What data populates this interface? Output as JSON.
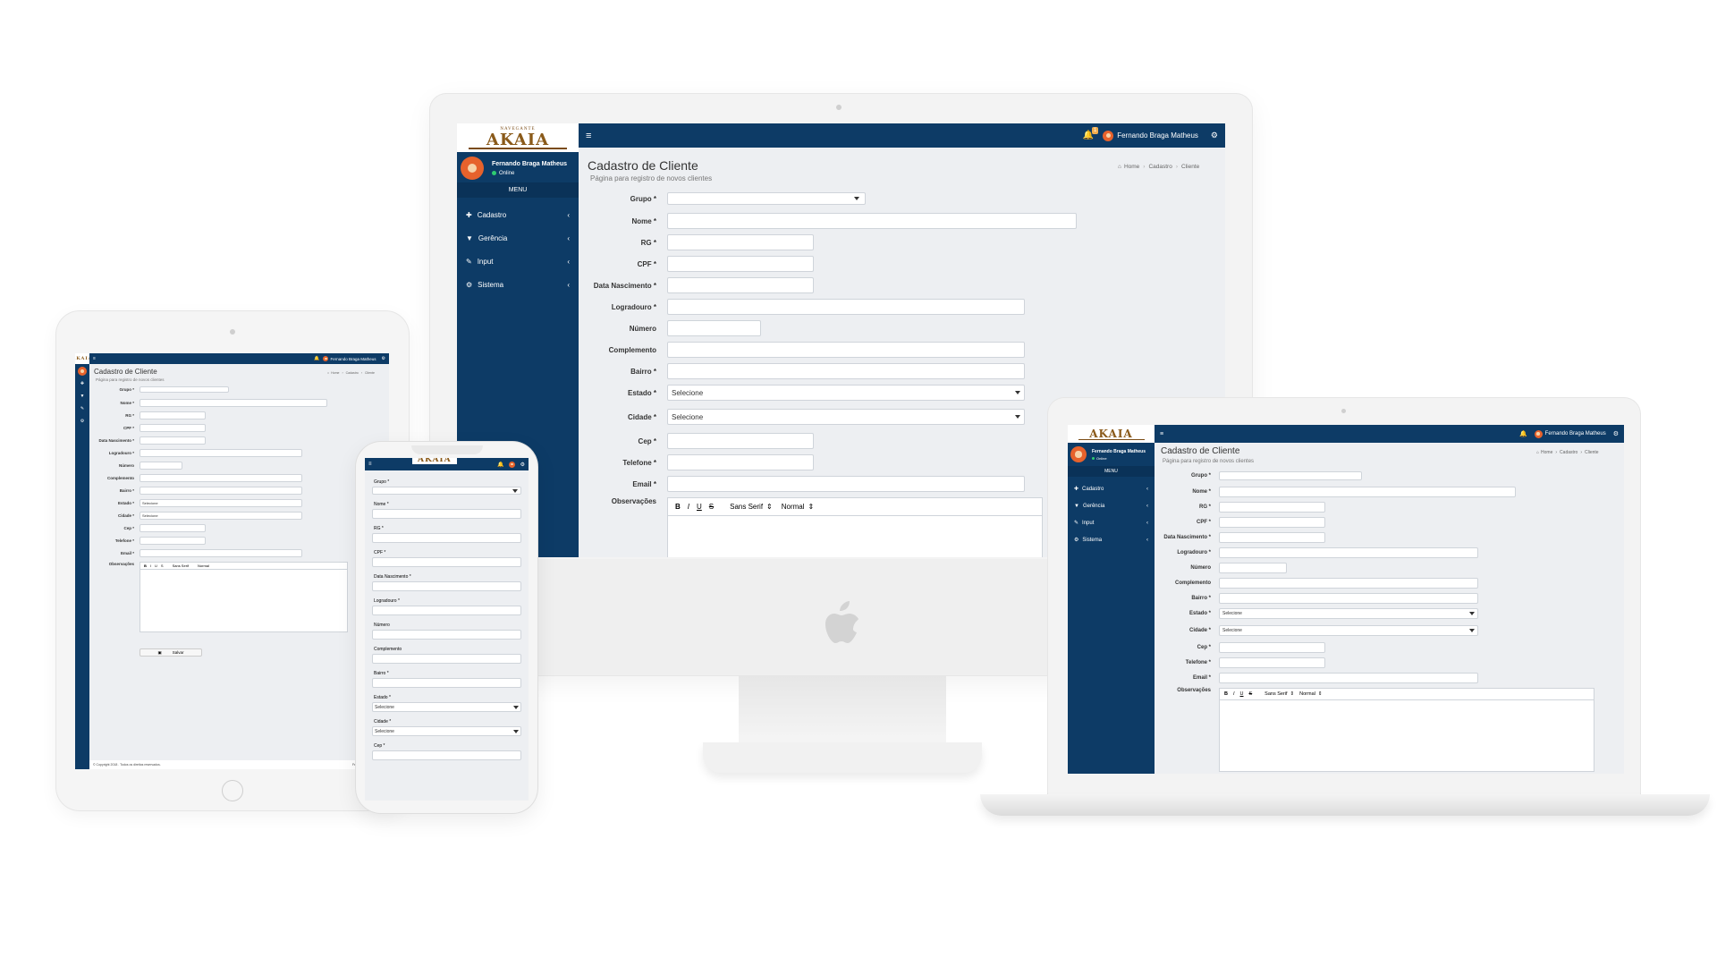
{
  "app": {
    "brand_top": "NAVEGANTE",
    "brand_name": "AKAIA",
    "page_title": "Cadastro de Cliente",
    "page_subtitle": "Página para registro de novos clientes",
    "user_name": "Fernando Braga Matheus",
    "user_status": "Online",
    "notification_count": "1",
    "menu_header": "MENU",
    "menu": [
      {
        "label": "Cadastro",
        "icon": "plus-icon"
      },
      {
        "label": "Gerência",
        "icon": "filter-icon"
      },
      {
        "label": "Input",
        "icon": "edit-icon"
      },
      {
        "label": "Sistema",
        "icon": "cogs-icon"
      }
    ],
    "breadcrumb": {
      "home": "Home",
      "section": "Cadastro",
      "current": "Cliente"
    },
    "fields": {
      "grupo": "Grupo *",
      "nome": "Nome *",
      "rg": "RG *",
      "cpf": "CPF *",
      "nascimento": "Data Nascimento *",
      "logradouro": "Logradouro *",
      "numero": "Número",
      "complemento": "Complemento",
      "bairro": "Bairro *",
      "estado": "Estado *",
      "cidade": "Cidade *",
      "cep": "Cep *",
      "telefone": "Telefone *",
      "email": "Email *",
      "observacoes": "Observações"
    },
    "select_placeholder": "Selecione",
    "editor": {
      "bold": "B",
      "italic": "I",
      "underline": "U",
      "strike": "S",
      "font": "Sans Serif",
      "size": "Normal"
    },
    "save_label": "Salvar",
    "footer_copyright": "© Copyright 2018 . Todos os direitos reservados.",
    "footer_right": "Fernando Matheus - De"
  },
  "colors": {
    "primary": "#0d3b66",
    "background": "#edeff2",
    "avatar": "#e6622c",
    "online": "#2ecc71",
    "badge": "#f0ad4e"
  }
}
